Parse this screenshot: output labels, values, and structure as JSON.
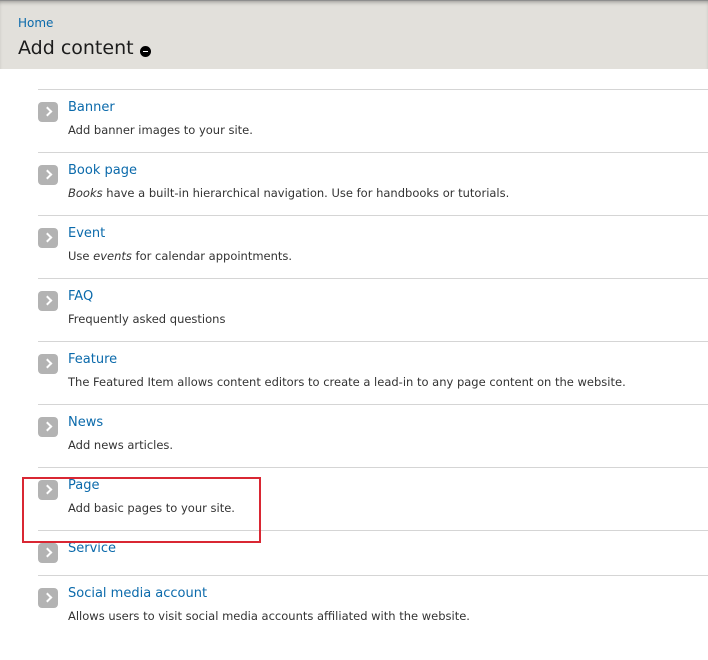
{
  "header": {
    "breadcrumb": "Home",
    "title": "Add content",
    "shortcut_icon": "remove-shortcut-icon"
  },
  "content_types": [
    {
      "label": "Banner",
      "desc_pre": "Add banner images to your site.",
      "desc_em": "",
      "desc_post": ""
    },
    {
      "label": "Book page",
      "desc_pre": "",
      "desc_em": "Books",
      "desc_post": " have a built-in hierarchical navigation. Use for handbooks or tutorials."
    },
    {
      "label": "Event",
      "desc_pre": "Use ",
      "desc_em": "events",
      "desc_post": " for calendar appointments."
    },
    {
      "label": "FAQ",
      "desc_pre": "Frequently asked questions",
      "desc_em": "",
      "desc_post": ""
    },
    {
      "label": "Feature",
      "desc_pre": "The Featured Item allows content editors to create a lead-in to any page content on the website.",
      "desc_em": "",
      "desc_post": ""
    },
    {
      "label": "News",
      "desc_pre": "Add news articles.",
      "desc_em": "",
      "desc_post": ""
    },
    {
      "label": "Page",
      "desc_pre": "Add basic pages to your site.",
      "desc_em": "",
      "desc_post": ""
    },
    {
      "label": "Service",
      "desc_pre": "",
      "desc_em": "",
      "desc_post": ""
    },
    {
      "label": "Social media account",
      "desc_pre": "Allows users to visit social media accounts affiliated with the website.",
      "desc_em": "",
      "desc_post": ""
    }
  ],
  "highlight_color": "#d92733",
  "link_color": "#0b6aab",
  "arrow_icon": "chevron-right-icon"
}
